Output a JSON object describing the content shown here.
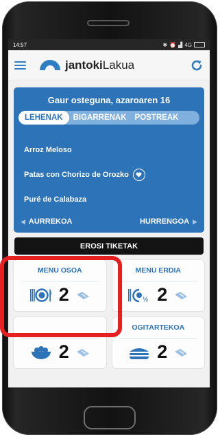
{
  "status": {
    "time": "14:57",
    "network": "4G"
  },
  "app": {
    "logo_bold": "jantoki",
    "logo_rest": "Lakua"
  },
  "menu": {
    "day_title": "Gaur osteguna, azaroaren 16",
    "tabs": [
      {
        "label": "LEHENAK",
        "active": true
      },
      {
        "label": "BIGARRENAK",
        "active": false
      },
      {
        "label": "POSTREAK",
        "active": false
      }
    ],
    "dishes": [
      "Arroz Meloso",
      "Patas con Chorizo de Orozko",
      "Puré de Calabaza"
    ],
    "prev_label": "AURREKOA",
    "next_label": "HURRENGOA"
  },
  "buy": {
    "label": "EROSI TIKETAK"
  },
  "tickets": [
    {
      "title": "MENU OSOA",
      "count": "2",
      "icon": "plate-cutlery-icon"
    },
    {
      "title": "MENU ERDIA",
      "count": "2",
      "icon": "half-plate-icon"
    },
    {
      "title": "",
      "count": "2",
      "icon": "salad-bowl-icon"
    },
    {
      "title": "OGITARTEKOA",
      "count": "2",
      "icon": "sandwich-icon"
    }
  ],
  "colors": {
    "primary": "#2d73b8",
    "highlight": "#e62020",
    "dark": "#131313"
  }
}
